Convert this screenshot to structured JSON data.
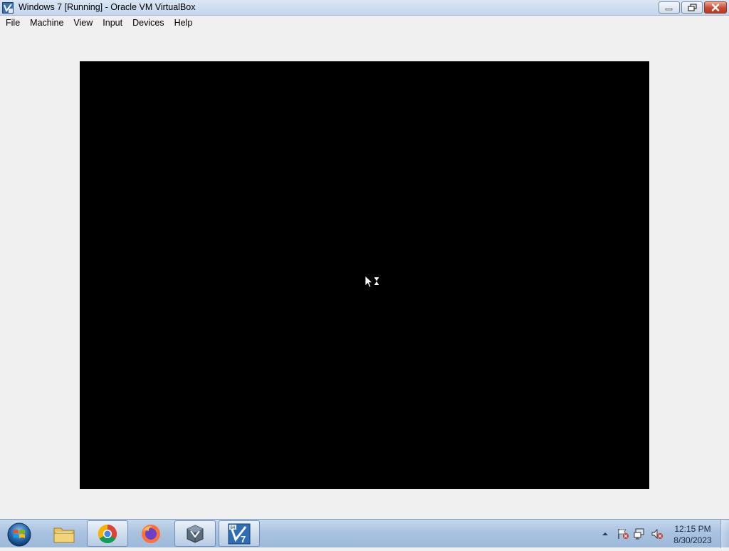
{
  "window": {
    "title": "Windows 7 [Running] - Oracle VM VirtualBox",
    "app_icon": "virtualbox-icon",
    "controls": [
      "minimize-icon",
      "restore-icon",
      "close-icon"
    ]
  },
  "menubar": {
    "items": [
      {
        "label": "File"
      },
      {
        "label": "Machine"
      },
      {
        "label": "View"
      },
      {
        "label": "Input"
      },
      {
        "label": "Devices"
      },
      {
        "label": "Help"
      }
    ]
  },
  "vm": {
    "state": "Running",
    "screen_color": "#000000",
    "cursor": "busy-cursor-icon"
  },
  "taskbar": {
    "start": "start-orb-icon",
    "pinned": [
      {
        "name": "explorer",
        "icon": "folder-icon",
        "active": false
      },
      {
        "name": "chrome",
        "icon": "chrome-icon",
        "active": true
      },
      {
        "name": "firefox",
        "icon": "firefox-icon",
        "active": false
      },
      {
        "name": "virtualbox",
        "icon": "virtualbox-icon",
        "active": true
      },
      {
        "name": "windows7-vm",
        "icon": "windows7-vm-icon",
        "active": true
      }
    ],
    "tray_icons": [
      "show-hidden-icons-arrow",
      "action-center-flag-icon",
      "network-icon",
      "volume-muted-icon"
    ],
    "clock": {
      "time": "12:15 PM",
      "date": "8/30/2023"
    }
  }
}
